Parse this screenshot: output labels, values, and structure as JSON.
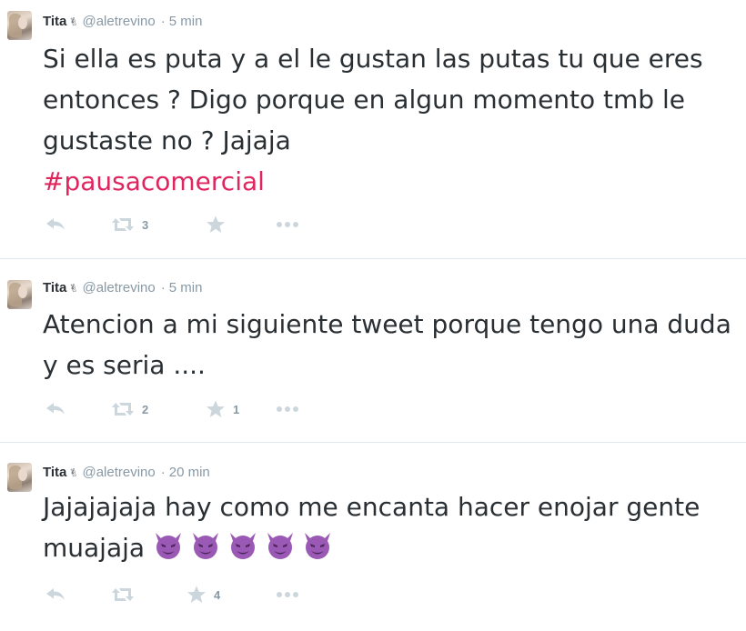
{
  "tweets": [
    {
      "name": "Tita",
      "handle": "@aletrevino",
      "time": "5 min",
      "text_main": "Si ella es puta y a el le gustan las putas tu que eres entonces ? Digo porque en algun momento tmb le gustaste no ? Jajaja",
      "hashtag": "#pausacomercial",
      "retweets": "3",
      "favorites": ""
    },
    {
      "name": "Tita",
      "handle": "@aletrevino",
      "time": "5 min",
      "text_main": "Atencion a mi siguiente tweet porque tengo una duda y es seria ....",
      "hashtag": "",
      "retweets": "2",
      "favorites": "1"
    },
    {
      "name": "Tita",
      "handle": "@aletrevino",
      "time": "20 min",
      "text_main": "Jajajajaja hay como me encanta hacer enojar gente muajaja",
      "hashtag": "",
      "retweets": "",
      "favorites": "4",
      "emoji": "smiling-imp",
      "emoji_count": 5
    }
  ],
  "colors": {
    "text": "#292f33",
    "muted": "#8899a6",
    "hashtag": "#e0245e",
    "emoji": "#9b59b6",
    "divider": "#e1e8ed"
  },
  "icons": [
    "reply-icon",
    "retweet-icon",
    "favorite-star-icon",
    "more-dots-icon",
    "verified-icon"
  ]
}
